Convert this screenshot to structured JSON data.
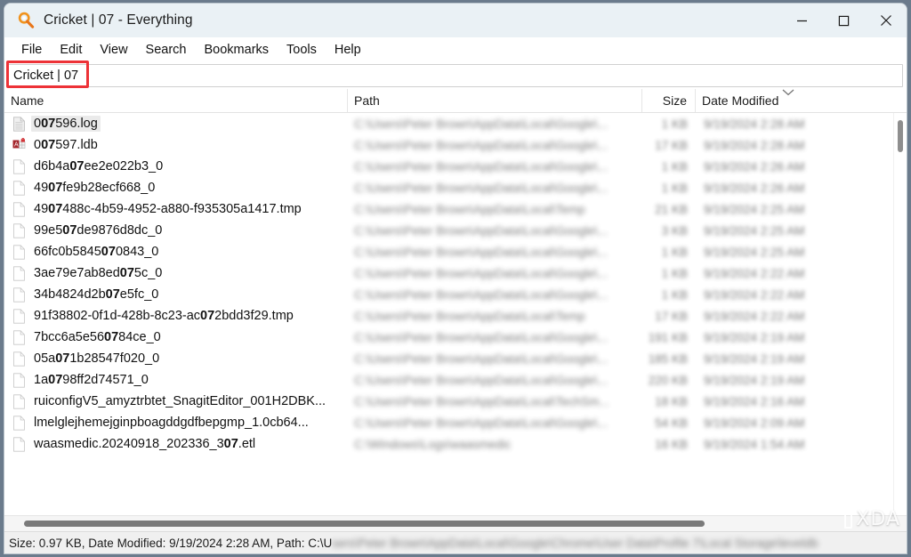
{
  "window": {
    "title": "Cricket | 07 - Everything",
    "app_icon": "magnifier-icon",
    "controls": {
      "minimize": "minimize-icon",
      "maximize": "maximize-icon",
      "close": "close-icon"
    }
  },
  "menu": {
    "items": [
      {
        "label": "File"
      },
      {
        "label": "Edit"
      },
      {
        "label": "View"
      },
      {
        "label": "Search"
      },
      {
        "label": "Bookmarks"
      },
      {
        "label": "Tools"
      },
      {
        "label": "Help"
      }
    ]
  },
  "search": {
    "value": "Cricket | 07",
    "placeholder": "",
    "highlight_color": "#ed3237"
  },
  "columns": [
    {
      "key": "name",
      "label": "Name"
    },
    {
      "key": "path",
      "label": "Path"
    },
    {
      "key": "size",
      "label": "Size"
    },
    {
      "key": "date",
      "label": "Date Modified",
      "sort_indicator": "chevron-down-icon"
    }
  ],
  "rows": [
    {
      "name_parts": [
        {
          "t": "0",
          "b": false
        },
        {
          "t": "07",
          "b": true
        },
        {
          "t": "596.log",
          "b": false
        }
      ],
      "icon": "log-file-icon",
      "path": "C:\\Users\\Peter Brown\\AppData\\Local\\Google\\...",
      "size": "1 KB",
      "date": "9/19/2024 2:28 AM",
      "selected": true
    },
    {
      "name_parts": [
        {
          "t": "0",
          "b": false
        },
        {
          "t": "07",
          "b": true
        },
        {
          "t": "597.ldb",
          "b": false
        }
      ],
      "icon": "access-locked-file-icon",
      "path": "C:\\Users\\Peter Brown\\AppData\\Local\\Google\\...",
      "size": "17 KB",
      "date": "9/19/2024 2:28 AM",
      "selected": false
    },
    {
      "name_parts": [
        {
          "t": "d6b4a",
          "b": false
        },
        {
          "t": "07",
          "b": true
        },
        {
          "t": "ee2e022b3_0",
          "b": false
        }
      ],
      "icon": "generic-file-icon",
      "path": "C:\\Users\\Peter Brown\\AppData\\Local\\Google\\...",
      "size": "1 KB",
      "date": "9/19/2024 2:26 AM",
      "selected": false
    },
    {
      "name_parts": [
        {
          "t": "49",
          "b": false
        },
        {
          "t": "07",
          "b": true
        },
        {
          "t": "fe9b28ecf668_0",
          "b": false
        }
      ],
      "icon": "generic-file-icon",
      "path": "C:\\Users\\Peter Brown\\AppData\\Local\\Google\\...",
      "size": "1 KB",
      "date": "9/19/2024 2:26 AM",
      "selected": false
    },
    {
      "name_parts": [
        {
          "t": "49",
          "b": false
        },
        {
          "t": "07",
          "b": true
        },
        {
          "t": "488c-4b59-4952-a880-f935305a1417.tmp",
          "b": false
        }
      ],
      "icon": "generic-file-icon",
      "path": "C:\\Users\\Peter Brown\\AppData\\Local\\Temp",
      "size": "21 KB",
      "date": "9/19/2024 2:25 AM",
      "selected": false
    },
    {
      "name_parts": [
        {
          "t": "99e5",
          "b": false
        },
        {
          "t": "07",
          "b": true
        },
        {
          "t": "de9876d8dc_0",
          "b": false
        }
      ],
      "icon": "generic-file-icon",
      "path": "C:\\Users\\Peter Brown\\AppData\\Local\\Google\\...",
      "size": "3 KB",
      "date": "9/19/2024 2:25 AM",
      "selected": false
    },
    {
      "name_parts": [
        {
          "t": "66fc0b5845",
          "b": false
        },
        {
          "t": "07",
          "b": true
        },
        {
          "t": "0843_0",
          "b": false
        }
      ],
      "icon": "generic-file-icon",
      "path": "C:\\Users\\Peter Brown\\AppData\\Local\\Google\\...",
      "size": "1 KB",
      "date": "9/19/2024 2:25 AM",
      "selected": false
    },
    {
      "name_parts": [
        {
          "t": "3ae79e7ab8ed",
          "b": false
        },
        {
          "t": "07",
          "b": true
        },
        {
          "t": "5c_0",
          "b": false
        }
      ],
      "icon": "generic-file-icon",
      "path": "C:\\Users\\Peter Brown\\AppData\\Local\\Google\\...",
      "size": "1 KB",
      "date": "9/19/2024 2:22 AM",
      "selected": false
    },
    {
      "name_parts": [
        {
          "t": "34b4824d2b",
          "b": false
        },
        {
          "t": "07",
          "b": true
        },
        {
          "t": "e5fc_0",
          "b": false
        }
      ],
      "icon": "generic-file-icon",
      "path": "C:\\Users\\Peter Brown\\AppData\\Local\\Google\\...",
      "size": "1 KB",
      "date": "9/19/2024 2:22 AM",
      "selected": false
    },
    {
      "name_parts": [
        {
          "t": "91f38802-0f1d-428b-8c23-ac",
          "b": false
        },
        {
          "t": "07",
          "b": true
        },
        {
          "t": "2bdd3f29.tmp",
          "b": false
        }
      ],
      "icon": "generic-file-icon",
      "path": "C:\\Users\\Peter Brown\\AppData\\Local\\Temp",
      "size": "17 KB",
      "date": "9/19/2024 2:22 AM",
      "selected": false
    },
    {
      "name_parts": [
        {
          "t": "7bcc6a5e56",
          "b": false
        },
        {
          "t": "07",
          "b": true
        },
        {
          "t": "84ce_0",
          "b": false
        }
      ],
      "icon": "generic-file-icon",
      "path": "C:\\Users\\Peter Brown\\AppData\\Local\\Google\\...",
      "size": "191 KB",
      "date": "9/19/2024 2:19 AM",
      "selected": false
    },
    {
      "name_parts": [
        {
          "t": "05a",
          "b": false
        },
        {
          "t": "07",
          "b": true
        },
        {
          "t": "1b28547f020_0",
          "b": false
        }
      ],
      "icon": "generic-file-icon",
      "path": "C:\\Users\\Peter Brown\\AppData\\Local\\Google\\...",
      "size": "185 KB",
      "date": "9/19/2024 2:19 AM",
      "selected": false
    },
    {
      "name_parts": [
        {
          "t": "1a",
          "b": false
        },
        {
          "t": "07",
          "b": true
        },
        {
          "t": "98ff2d74571_0",
          "b": false
        }
      ],
      "icon": "generic-file-icon",
      "path": "C:\\Users\\Peter Brown\\AppData\\Local\\Google\\...",
      "size": "220 KB",
      "date": "9/19/2024 2:19 AM",
      "selected": false
    },
    {
      "name_parts": [
        {
          "t": "ruiconfigV5_amyztrbtet_SnagitEditor_001H2DBK...",
          "b": false
        }
      ],
      "icon": "generic-file-icon",
      "path": "C:\\Users\\Peter Brown\\AppData\\Local\\TechSm...",
      "size": "18 KB",
      "date": "9/19/2024 2:16 AM",
      "selected": false
    },
    {
      "name_parts": [
        {
          "t": "lmelglejhemejginpboagddgdfbepgmp_1.0cb64...",
          "b": false
        }
      ],
      "icon": "generic-file-icon",
      "path": "C:\\Users\\Peter Brown\\AppData\\Local\\Google\\...",
      "size": "54 KB",
      "date": "9/19/2024 2:09 AM",
      "selected": false
    },
    {
      "name_parts": [
        {
          "t": "waasmedic.20240918_202336_3",
          "b": false
        },
        {
          "t": "07",
          "b": true
        },
        {
          "t": ".etl",
          "b": false
        }
      ],
      "icon": "generic-file-icon",
      "path": "C:\\Windows\\Logs\\waasmedic",
      "size": "16 KB",
      "date": "9/19/2024 1:54 AM",
      "selected": false
    }
  ],
  "status_bar": {
    "visible_text": "Size: 0.97 KB, Date Modified: 9/19/2024 2:28 AM, Path: C:\\U",
    "blurred_text": "sers\\Peter Brown\\AppData\\Local\\Google\\Chrome\\User Data\\Profile 7\\Local Storage\\leveldb"
  },
  "watermark": {
    "text": "XDA"
  }
}
